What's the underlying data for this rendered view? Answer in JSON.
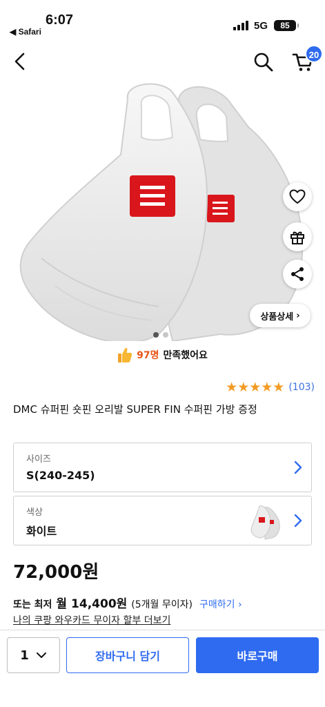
{
  "status_bar": {
    "time": "6:07",
    "back_app": "◀ Safari",
    "network": "5G",
    "battery": "85"
  },
  "nav": {
    "cart_count": "20"
  },
  "hero": {
    "detail_button": "상품상세",
    "detail_chevron": "›"
  },
  "satisfaction": {
    "count": "97명",
    "text": "만족했어요"
  },
  "rating": {
    "stars": "★★★★★",
    "review_count": "(103)"
  },
  "product": {
    "title": "DMC 슈퍼핀 숏핀 오리발 SUPER FIN 수퍼핀 가방 증정"
  },
  "options": {
    "size": {
      "label": "사이즈",
      "value": "S(240-245)"
    },
    "color": {
      "label": "색상",
      "value": "화이트"
    }
  },
  "pricing": {
    "price": "72,000원",
    "install_prefix": "또는 최저",
    "install_month": "월",
    "install_amount": "14,400원",
    "install_terms": "(5개월 무이자)",
    "install_link": "구매하기 ›",
    "card_link": "나의 쿠팡 와우카드 무이자 할부 더보기"
  },
  "bottom_bar": {
    "quantity": "1",
    "add_to_cart": "장바구니 담기",
    "buy_now": "바로구매"
  },
  "colors": {
    "accent": "#2f6bf0",
    "rating_star": "#f39a23",
    "highlight": "#e8551a",
    "logo_red": "#d9161c"
  }
}
